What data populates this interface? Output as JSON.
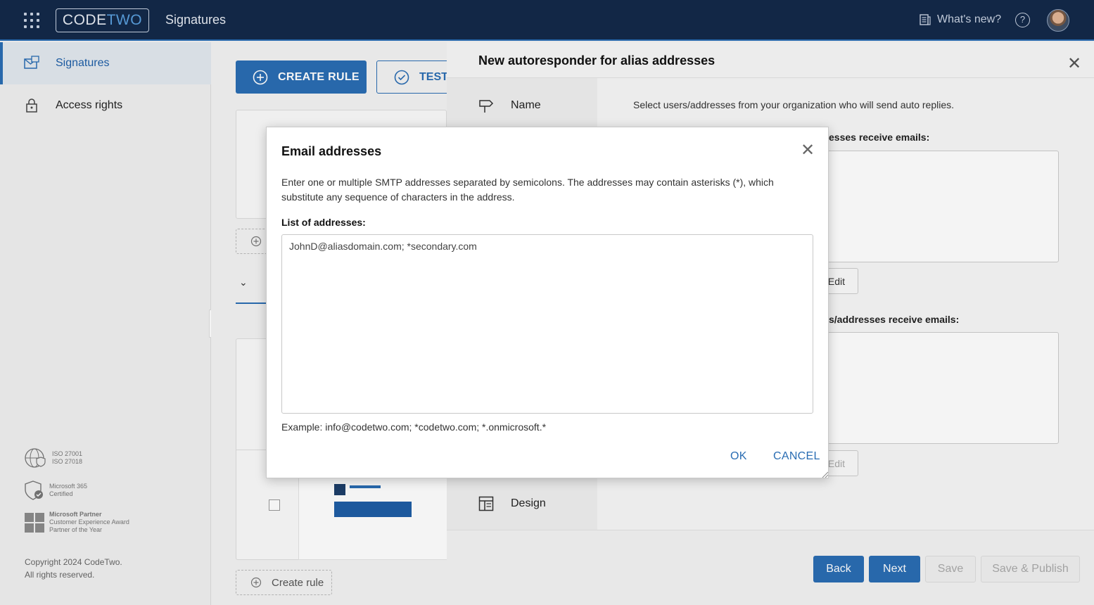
{
  "topbar": {
    "logo_code": "CODE",
    "logo_two": "TWO",
    "app_title": "Signatures",
    "whats_new": "What's new?",
    "help": "?"
  },
  "sidebar": {
    "items": [
      {
        "label": "Signatures",
        "icon": "signature-icon",
        "active": true
      },
      {
        "label": "Access rights",
        "icon": "lock-icon",
        "active": false
      }
    ],
    "certs": [
      {
        "line1": "ISO 27001",
        "line2": "ISO 27018"
      },
      {
        "line1": "Microsoft 365",
        "line2": "Certified"
      },
      {
        "line1": "Microsoft Partner",
        "line2": "Customer Experience Award",
        "line3": "Partner of the Year"
      }
    ],
    "copyright_line1": "Copyright 2024 CodeTwo.",
    "copyright_line2": "All rights reserved."
  },
  "main": {
    "create_rule_button": "CREATE RULE",
    "test_button": "TEST",
    "create_rule_link": "Create rule"
  },
  "panel": {
    "title": "New autoresponder for alias addresses",
    "steps": [
      {
        "label": "Name",
        "icon": "signpost-icon"
      },
      {
        "label": "Design",
        "icon": "layout-icon"
      }
    ],
    "instruction": "Select users/addresses from your organization who will send auto replies.",
    "section1_heading": "esses receive emails:",
    "section2_heading": "s/addresses receive emails:",
    "edit_label": "Edit",
    "footer": {
      "back": "Back",
      "next": "Next",
      "save": "Save",
      "save_publish": "Save & Publish"
    }
  },
  "modal": {
    "title": "Email addresses",
    "description": "Enter one or multiple SMTP addresses separated by semicolons. The addresses may contain asterisks (*), which substitute any sequence of characters in the address.",
    "list_label": "List of addresses:",
    "addresses_value": "JohnD@aliasdomain.com; *secondary.com",
    "example": "Example: info@codetwo.com; *codetwo.com; *.onmicrosoft.*",
    "ok": "OK",
    "cancel": "CANCEL"
  },
  "colors": {
    "topbar_bg": "#13294a",
    "accent": "#2a6db3",
    "sidebar_active_bg": "#e2e8ef"
  }
}
